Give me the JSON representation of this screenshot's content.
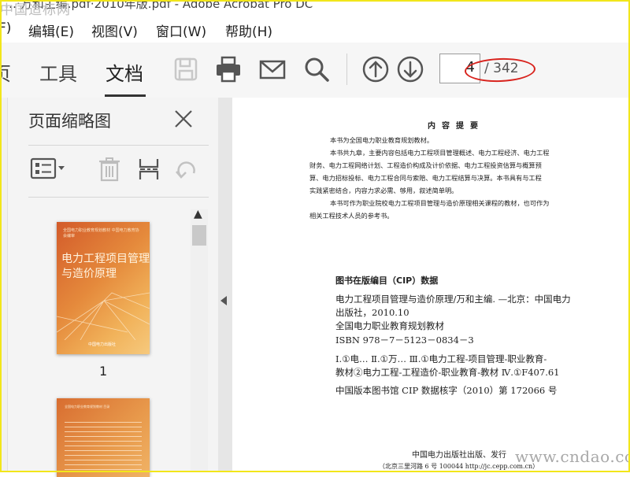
{
  "window": {
    "title_fragment": "…·万和主编.pdf·2010年版.pdf - Adobe Acrobat Pro DC",
    "watermark_top": "中国造标网"
  },
  "menu": [
    "F)",
    "编辑(E)",
    "视图(V)",
    "窗口(W)",
    "帮助(H)"
  ],
  "tabs": {
    "home_partial": "页",
    "tools": "工具",
    "document": "文档"
  },
  "toolbar": {
    "icons": [
      "save-icon",
      "print-icon",
      "email-icon",
      "search-icon",
      "page-up-icon",
      "page-down-icon"
    ],
    "page_current": "4",
    "page_total": "/ 342",
    "annotation_color": "#d8231d"
  },
  "panel": {
    "title": "页面缩略图",
    "icons": [
      "thumbnail-options-icon",
      "delete-icon",
      "insert-page-icon",
      "rotate-icon"
    ],
    "thumbnails": [
      {
        "label": "1",
        "cover_top": "全国电力职业教育规划教材 中国电力教育协会编审",
        "cover_title": [
          "电力工程项目管理",
          "与造价原理"
        ],
        "cover_publisher": "中国电力出版社"
      },
      {
        "label": "",
        "header": "全国电力职业教育规划教材 目录"
      }
    ]
  },
  "document": {
    "summary_title": "内容提要",
    "summary_lines": [
      "本书为全国电力职业教育规划教材。",
      "本书共九章，主要内容包括电力工程项目管理概述、电力工程经济、电力工程",
      "财务、电力工程网络计划、工程造价构成及计价依据、电力工程投资估算与概算预",
      "算、电力招标投标、电力工程合同与索赔、电力工程结算与决算。本书具有与工程",
      "实践紧密结合，内容力求必需、够用，叙述简单明。",
      "本书可作为职业院校电力工程项目管理与造价原理相关课程的教材，也可作为",
      "相关工程技术人员的参考书。"
    ],
    "cip_heading": "图书在版编目（CIP）数据",
    "cip_lines": [
      "电力工程项目管理与造价原理/万和主编. —北京：中国电力",
      "出版社，2010.10",
      "全国电力职业教育规划教材",
      "ISBN 978－7－5123－0834－3",
      "Ⅰ.①电…  Ⅱ.①万…  Ⅲ.①电力工程-项目管理-职业教育-",
      "教材②电力工程-工程造价-职业教育-教材  Ⅳ.①F407.61",
      "中国版本图书馆 CIP 数据核字（2010）第 172066 号"
    ],
    "publisher_line": "中国电力出版社出版、发行",
    "address_line": "（北京三里河路 6 号  100044  http://jc.cepp.com.cn）",
    "watermark": "www.cndao.com"
  }
}
